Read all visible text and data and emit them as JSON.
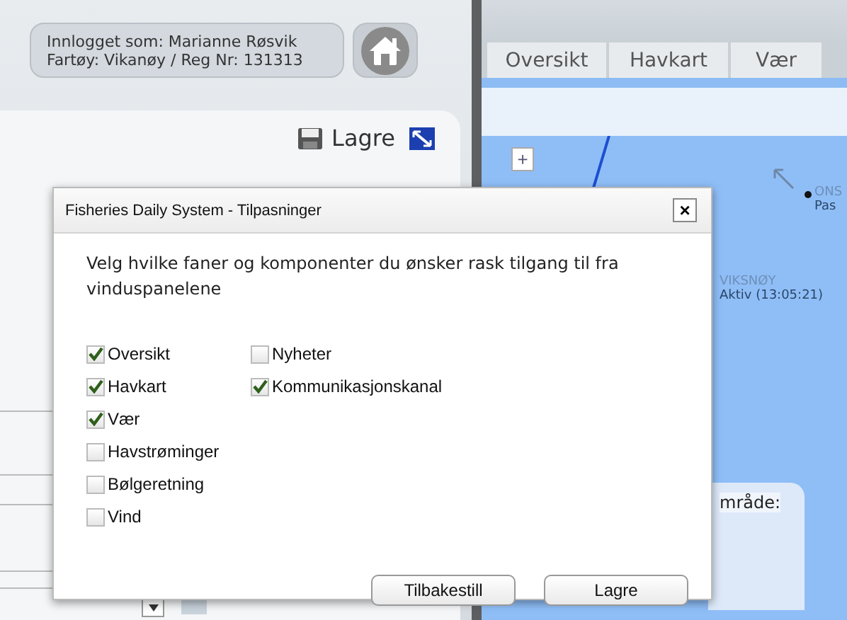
{
  "header": {
    "login_lines": [
      "Innlogget som: Marianne Røsvik",
      "Fartøy: Vikanøy / Reg Nr: 131313"
    ]
  },
  "left_panel": {
    "save_label": "Lagre"
  },
  "map": {
    "tabs": [
      {
        "label": "Oversikt"
      },
      {
        "label": "Havkart"
      },
      {
        "label": "Vær"
      }
    ],
    "zoom_in": "+",
    "vessels": [
      {
        "name": "ONS",
        "status": "Pas"
      },
      {
        "name": "VIKSNØY",
        "status": "Aktiv (13:05:21)"
      }
    ],
    "area_panel_label": "mråde:"
  },
  "dialog": {
    "title": "Fisheries Daily System - Tilpasninger",
    "close": "×",
    "instructions": "Velg hvilke faner og komponenter du ønsker rask tilgang til fra vinduspanelene",
    "columns": [
      [
        {
          "label": "Oversikt",
          "checked": true
        },
        {
          "label": "Havkart",
          "checked": true
        },
        {
          "label": "Vær",
          "checked": true
        },
        {
          "label": "Havstrøminger",
          "checked": false
        },
        {
          "label": "Bølgeretning",
          "checked": false
        },
        {
          "label": "Vind",
          "checked": false
        }
      ],
      [
        {
          "label": "Nyheter",
          "checked": false
        },
        {
          "label": "Kommunikasjonskanal",
          "checked": true
        }
      ]
    ],
    "buttons": [
      "Tilbakestill",
      "Lagre"
    ]
  }
}
